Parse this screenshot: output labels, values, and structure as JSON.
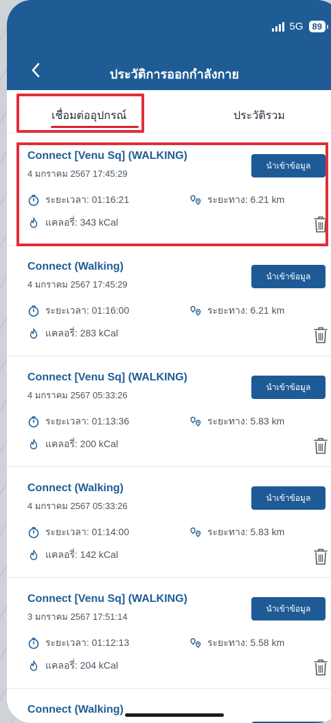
{
  "status_bar": {
    "network": "5G",
    "battery": "89"
  },
  "nav": {
    "back_icon": "chevron-left-icon",
    "title": "ประวัติการออกกำลังกาย"
  },
  "tabs": [
    {
      "label": "เชื่อมต่ออุปกรณ์",
      "active": true
    },
    {
      "label": "ประวัติรวม",
      "active": false
    }
  ],
  "labels": {
    "duration": "ระยะเวลา:",
    "distance": "ระยะทาง:",
    "calories": "แคลอรี่:",
    "import_button": "นำเข้าข้อมูล"
  },
  "records": [
    {
      "title": "Connect [Venu Sq] (WALKING)",
      "date": "4 มกราคม 2567 17:45:29",
      "duration": "01:16:21",
      "distance": "6.21 km",
      "calories": "343 kCal",
      "highlighted": true
    },
    {
      "title": "Connect (Walking)",
      "date": "4 มกราคม 2567 17:45:29",
      "duration": "01:16:00",
      "distance": "6.21 km",
      "calories": "283 kCal"
    },
    {
      "title": "Connect [Venu Sq] (WALKING)",
      "date": "4 มกราคม 2567 05:33:26",
      "duration": "01:13:36",
      "distance": "5.83 km",
      "calories": "200 kCal"
    },
    {
      "title": "Connect (Walking)",
      "date": "4 มกราคม 2567 05:33:26",
      "duration": "01:14:00",
      "distance": "5.83 km",
      "calories": "142 kCal"
    },
    {
      "title": "Connect [Venu Sq] (WALKING)",
      "date": "3 มกราคม 2567 17:51:14",
      "duration": "01:12:13",
      "distance": "5.58 km",
      "calories": "204 kCal"
    }
  ],
  "partial_record": {
    "title": "Connect (Walking)"
  },
  "colors": {
    "header": "#1f5c96",
    "accent_red": "#e12d39",
    "title_blue": "#1e5d96"
  }
}
